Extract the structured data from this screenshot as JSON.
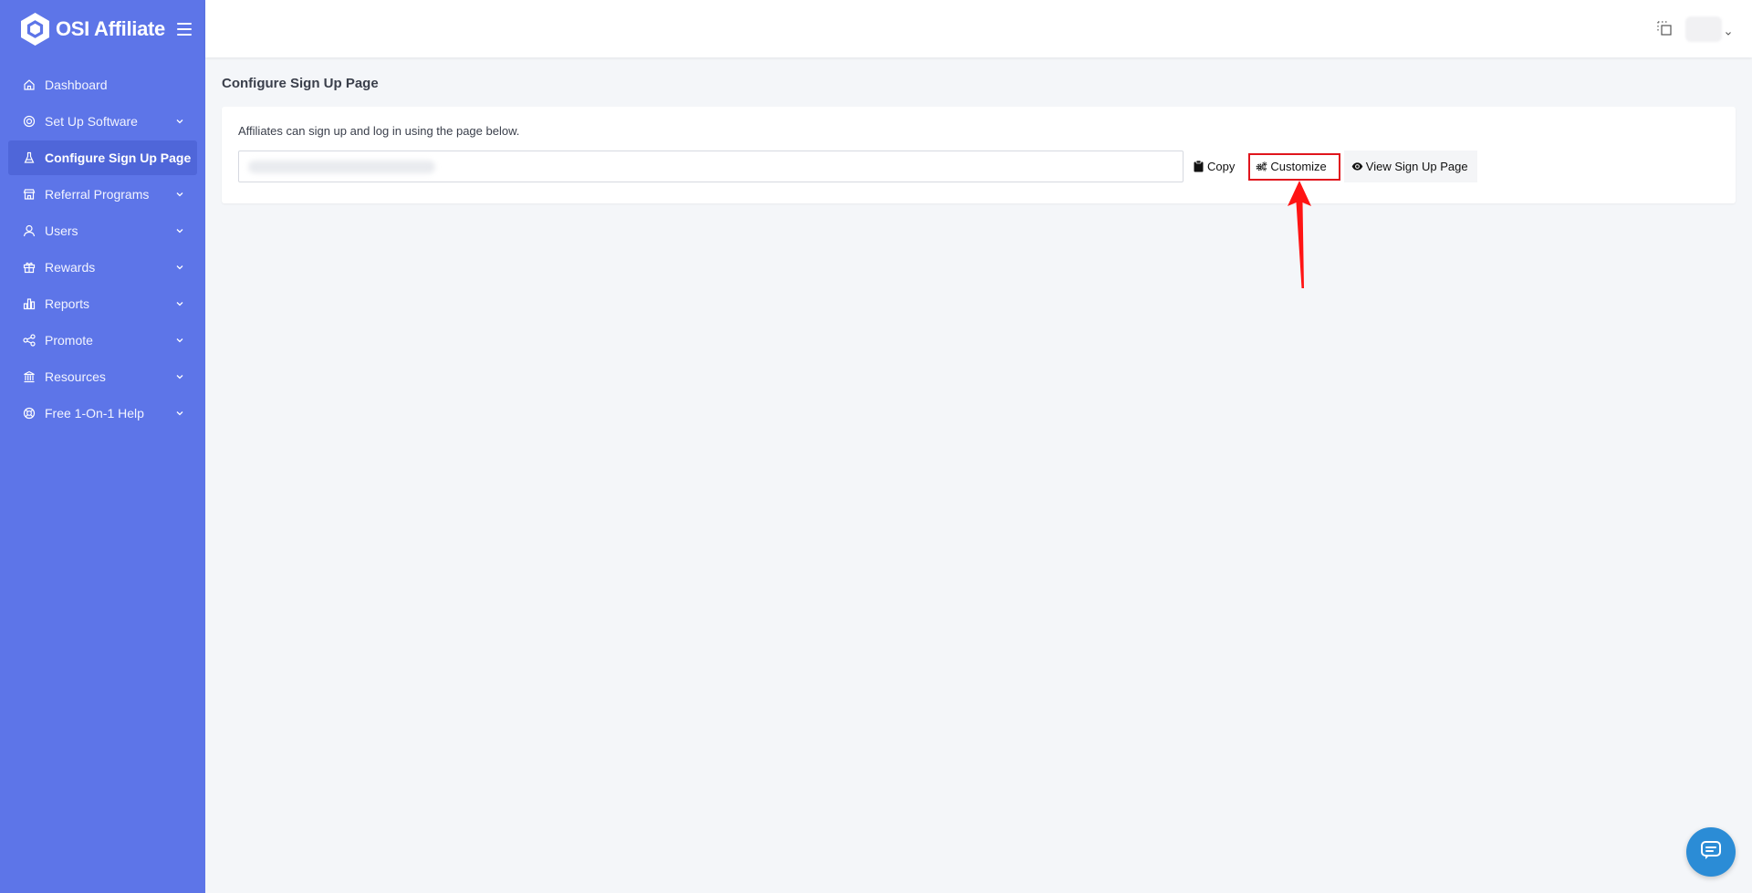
{
  "brand": {
    "name": "OSI Affiliate",
    "logo_icon": "hexagon-logo-icon"
  },
  "sidebar": {
    "items": [
      {
        "label": "Dashboard",
        "icon": "home-icon",
        "has_submenu": false,
        "active": false
      },
      {
        "label": "Set Up Software",
        "icon": "target-icon",
        "has_submenu": true,
        "active": false
      },
      {
        "label": "Configure Sign Up Page",
        "icon": "flask-icon",
        "has_submenu": false,
        "active": true
      },
      {
        "label": "Referral Programs",
        "icon": "store-icon",
        "has_submenu": true,
        "active": false
      },
      {
        "label": "Users",
        "icon": "user-icon",
        "has_submenu": true,
        "active": false
      },
      {
        "label": "Rewards",
        "icon": "gift-icon",
        "has_submenu": true,
        "active": false
      },
      {
        "label": "Reports",
        "icon": "bar-chart-icon",
        "has_submenu": true,
        "active": false
      },
      {
        "label": "Promote",
        "icon": "share-icon",
        "has_submenu": true,
        "active": false
      },
      {
        "label": "Resources",
        "icon": "bank-icon",
        "has_submenu": true,
        "active": false
      },
      {
        "label": "Free 1-On-1 Help",
        "icon": "lifebuoy-icon",
        "has_submenu": true,
        "active": false
      }
    ]
  },
  "page": {
    "title": "Configure Sign Up Page",
    "description": "Affiliates can sign up and log in using the page below.",
    "buttons": {
      "copy": "Copy",
      "customize": "Customize",
      "view": "View Sign Up Page"
    }
  },
  "colors": {
    "sidebar": "#5d75e8",
    "sidebar_active": "#4f66d9",
    "highlight": "#e0151d",
    "chat": "#2b8cd6"
  }
}
